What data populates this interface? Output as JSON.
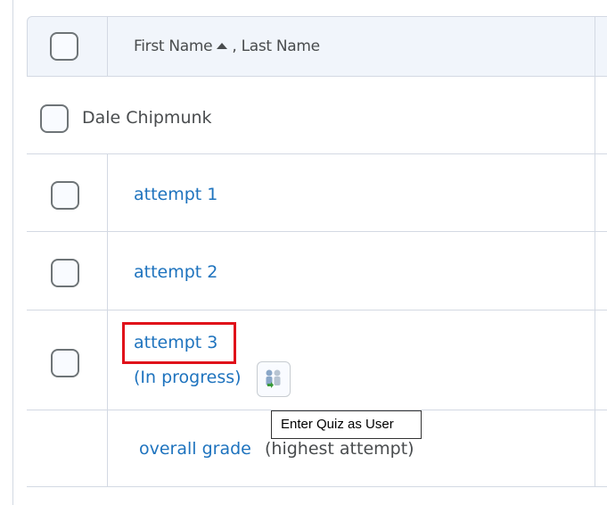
{
  "table": {
    "header": {
      "first_name": "First Name",
      "separator": ", ",
      "last_name": "Last Name",
      "sort_icon": "sort-ascending-triangle"
    },
    "user": {
      "name": "Dale Chipmunk"
    },
    "attempts": [
      {
        "label": "attempt 1"
      },
      {
        "label": "attempt 2"
      },
      {
        "label": "attempt 3",
        "status": "(In progress)"
      }
    ],
    "overall": {
      "link": "overall grade",
      "note": "(highest attempt)"
    }
  },
  "enter_quiz_icon": "enter-quiz-as-user-icon",
  "tooltip": "Enter Quiz as User",
  "colors": {
    "link": "#1e73be",
    "highlight": "#e0101a",
    "header_bg": "#f1f5fb",
    "border": "#d3d9e3"
  }
}
